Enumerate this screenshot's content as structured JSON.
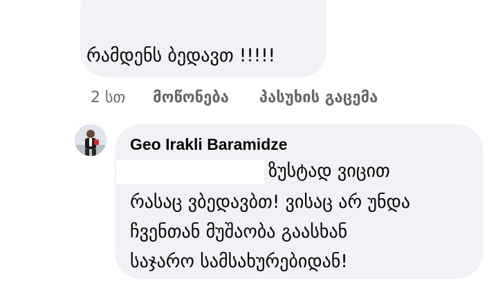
{
  "parent_comment": {
    "text": "რამდენს ბედავთ !!!!!"
  },
  "comment_actions": {
    "time": "2 სთ",
    "like_label": "მოწონება",
    "reply_label": "პასუხის გაცემა"
  },
  "reply": {
    "author": "Geo Irakli Baramidze",
    "lines": [
      "ზუსტად ვიცით",
      "რასაც ვბედავბთ! ვისაც არ უნდა",
      "ჩვენთან მუშაობა გაასხან",
      "საჯარო სამსახურებიდან!"
    ]
  },
  "colors": {
    "bubble_background": "#f0f2f5",
    "primary_text": "#050505",
    "secondary_text": "#65676b"
  }
}
